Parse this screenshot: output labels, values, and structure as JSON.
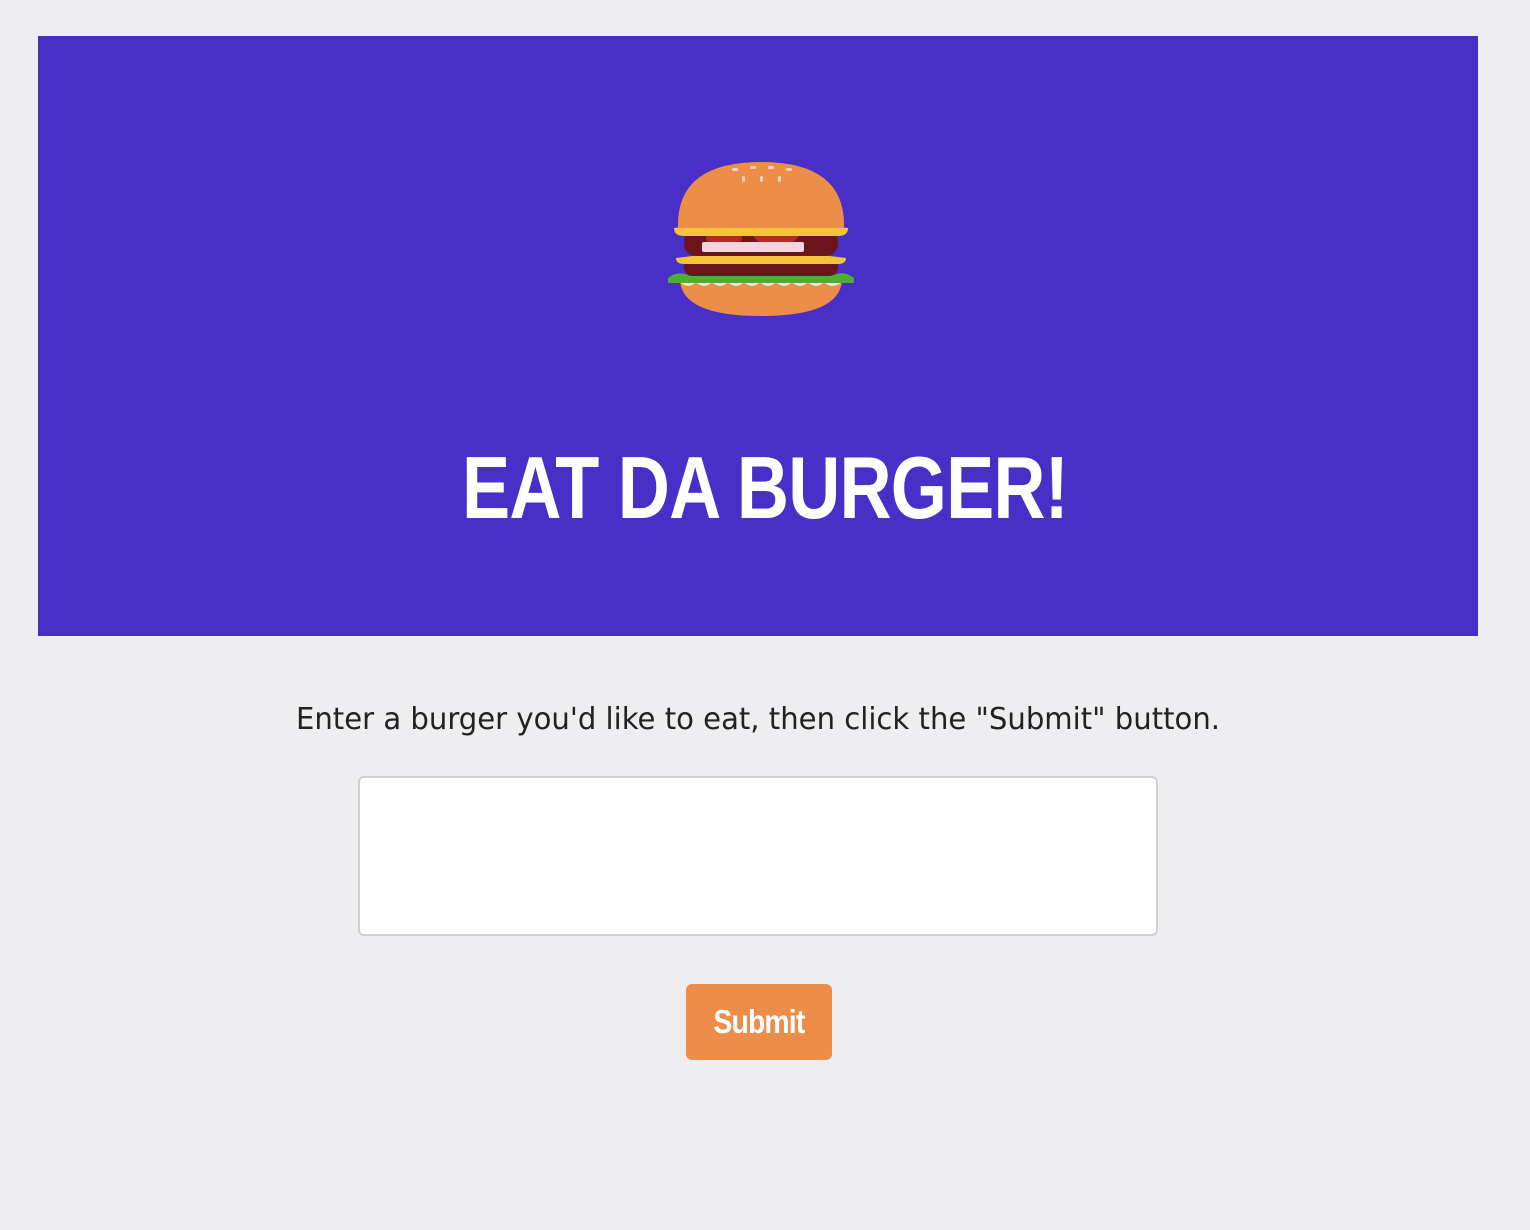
{
  "hero": {
    "icon": "burger-icon",
    "title": "EAT DA BURGER!",
    "background_color": "#482fc7"
  },
  "form": {
    "instructions": "Enter a burger you'd like to eat, then click the \"Submit\" button.",
    "input_value": "",
    "submit_label": "Submit",
    "submit_color": "#ec8e4a"
  }
}
